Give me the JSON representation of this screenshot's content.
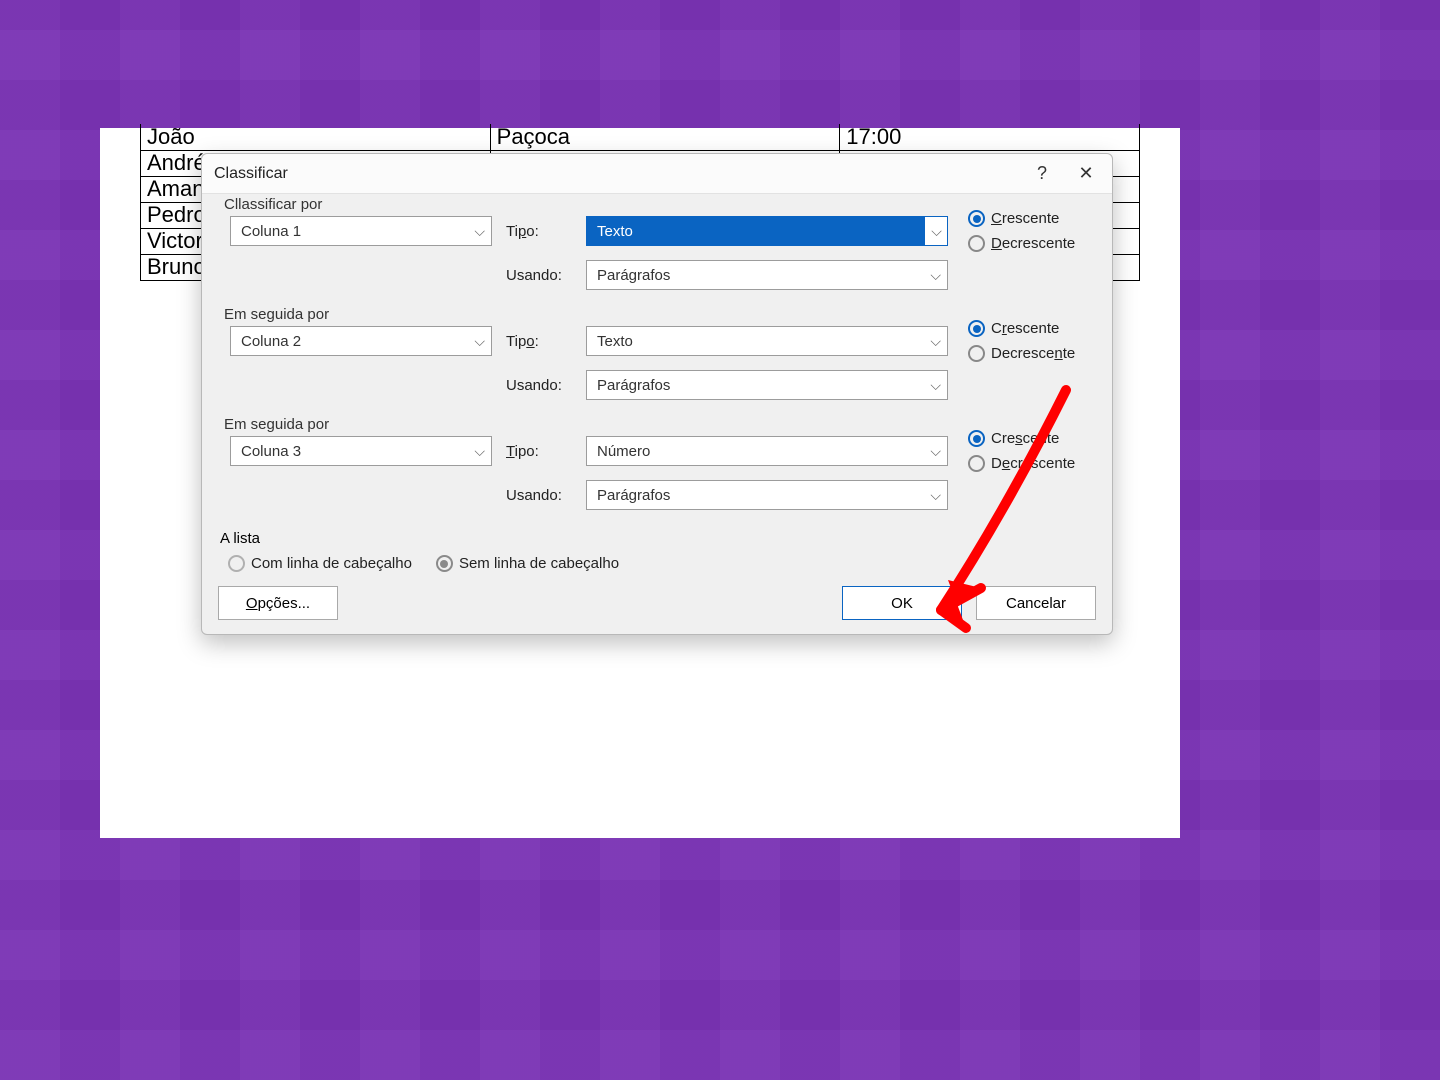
{
  "table": {
    "rows": [
      [
        "João",
        "Paçoca",
        "17:00"
      ],
      [
        "André",
        "",
        ""
      ],
      [
        "Amanda",
        "",
        ""
      ],
      [
        "Pedro",
        "",
        ""
      ],
      [
        "Victor",
        "",
        ""
      ],
      [
        "Bruno",
        "",
        ""
      ]
    ]
  },
  "dialog": {
    "title": "Classificar",
    "help_tooltip": "?",
    "close_tooltip": "✕",
    "group1": {
      "legend": "Classificar por",
      "legend_underline": "l",
      "column": "Coluna 1",
      "type_label": "Tipo:",
      "type_underline": "p",
      "type_value": "Texto",
      "using_label": "Usando:",
      "using_value": "Parágrafos",
      "asc": "Crescente",
      "asc_underline": "C",
      "desc": "Decrescente",
      "desc_underline": "D",
      "selected": "asc"
    },
    "group2": {
      "legend": "Em seguida por",
      "legend_underline": "m",
      "column": "Coluna 2",
      "type_label": "Tipo:",
      "type_underline": "o",
      "type_value": "Texto",
      "using_label": "Usando:",
      "using_value": "Parágrafos",
      "asc": "Crescente",
      "asc_underline": "r",
      "desc": "Decrescente",
      "desc_underline": "n",
      "selected": "asc"
    },
    "group3": {
      "legend": "Em seguida por",
      "legend_underline": "u",
      "column": "Coluna 3",
      "type_label": "Tipo:",
      "type_underline": "T",
      "type_value": "Número",
      "using_label": "Usando:",
      "using_value": "Parágrafos",
      "asc": "Crescente",
      "asc_underline": "s",
      "desc": "Decrescente",
      "desc_underline": "e",
      "selected": "asc"
    },
    "list": {
      "legend": "A lista",
      "with_header": "Com linha de cabeçalho",
      "without_header": "Sem linha de cabeçalho",
      "selected": "without"
    },
    "buttons": {
      "options": "Opções...",
      "options_underline": "O",
      "ok": "OK",
      "cancel": "Cancelar"
    }
  }
}
